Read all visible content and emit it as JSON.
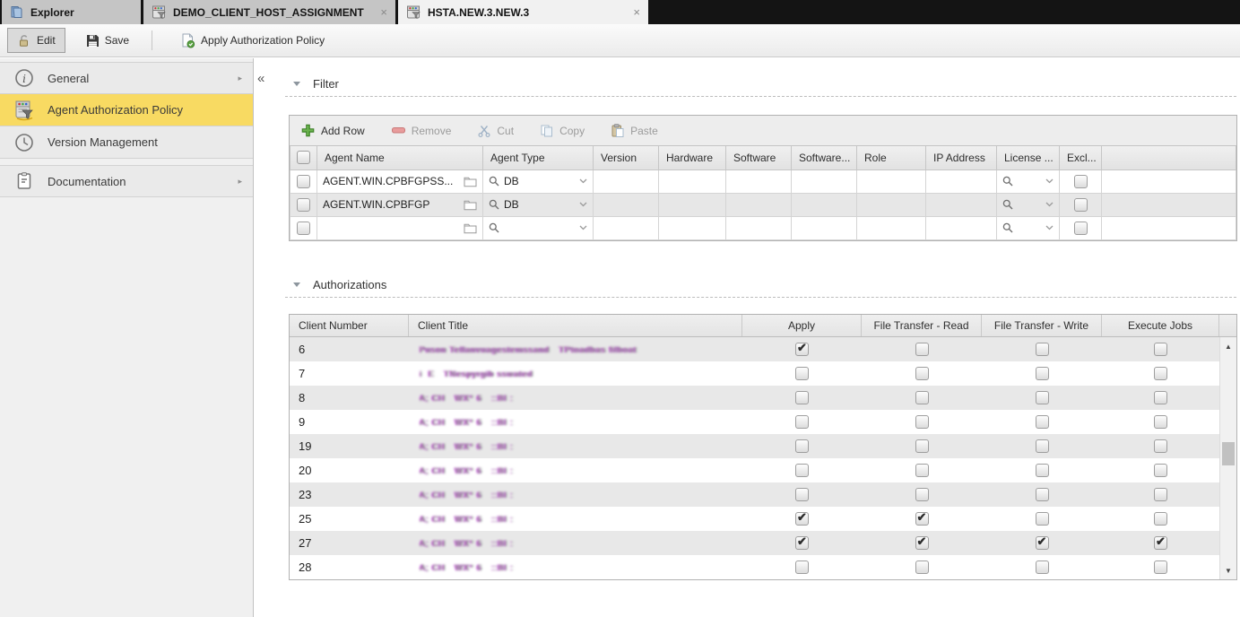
{
  "tabbar": {
    "tabs": [
      {
        "label": "Explorer",
        "icon": "explorer-folder-icon",
        "active": false,
        "closable": false
      },
      {
        "label": "DEMO_CLIENT_HOST_ASSIGNMENT",
        "icon": "host-object-icon",
        "active": false,
        "closable": true
      },
      {
        "label": "HSTA.NEW.3.NEW.3",
        "icon": "host-object-icon",
        "active": true,
        "closable": true
      }
    ],
    "close_glyph": "×"
  },
  "toolbar": {
    "buttons": [
      {
        "label": "Edit",
        "icon": "unlock-icon",
        "pressed": true
      },
      {
        "label": "Save",
        "icon": "save-icon",
        "pressed": false
      },
      {
        "label": "Apply Authorization Policy",
        "icon": "apply-policy-icon",
        "pressed": false
      }
    ]
  },
  "sidebar": {
    "collapse_glyph": "«",
    "items": [
      {
        "label": "General",
        "icon": "info-icon",
        "selected": false,
        "expand_arrow": "▸"
      },
      {
        "label": "Agent Authorization Policy",
        "icon": "agent-policy-icon",
        "selected": true,
        "expand_arrow": ""
      },
      {
        "label": "Version Management",
        "icon": "clock-icon",
        "selected": false,
        "expand_arrow": ""
      },
      {
        "label": "Documentation",
        "icon": "documentation-icon",
        "selected": false,
        "expand_arrow": "▸"
      }
    ]
  },
  "filter_section": {
    "title": "Filter",
    "table": {
      "toolbar": [
        {
          "label": "Add Row",
          "icon": "add-row-icon",
          "enabled": true
        },
        {
          "label": "Remove",
          "icon": "remove-row-icon",
          "enabled": false
        },
        {
          "label": "Cut",
          "icon": "cut-icon",
          "enabled": false
        },
        {
          "label": "Copy",
          "icon": "copy-icon",
          "enabled": false
        },
        {
          "label": "Paste",
          "icon": "paste-icon",
          "enabled": false
        }
      ],
      "columns": [
        "Agent Name",
        "Agent Type",
        "Version",
        "Hardware",
        "Software",
        "Software...",
        "Role",
        "IP Address",
        "License ...",
        "Excl..."
      ],
      "rows": [
        {
          "selected": false,
          "agent_name": "AGENT.WIN.CPBFGPSS...",
          "agent_type": "DB",
          "version": "",
          "hardware": "",
          "software": "",
          "software2": "",
          "role": "",
          "ip_address": "",
          "license": "",
          "excluded": false
        },
        {
          "selected": false,
          "agent_name": "AGENT.WIN.CPBFGP",
          "agent_type": "DB",
          "version": "",
          "hardware": "",
          "software": "",
          "software2": "",
          "role": "",
          "ip_address": "",
          "license": "",
          "excluded": false
        },
        {
          "selected": false,
          "agent_name": "",
          "agent_type": "",
          "version": "",
          "hardware": "",
          "software": "",
          "software2": "",
          "role": "",
          "ip_address": "",
          "license": "",
          "excluded": false
        }
      ]
    }
  },
  "authorizations_section": {
    "title": "Authorizations",
    "table": {
      "columns": [
        "Client Number",
        "Client Title",
        "Apply",
        "File Transfer - Read",
        "File Transfer - Write",
        "Execute Jobs"
      ],
      "rows": [
        {
          "client_number": "6",
          "client_title": "Puson Tellanvuagestemssand   TPtoadbas filboat",
          "title_redacted": true,
          "apply": true,
          "file_transfer_read": false,
          "file_transfer_write": false,
          "execute_jobs": false
        },
        {
          "client_number": "7",
          "client_title": "i  E   TNespyrgib sswated",
          "title_redacted": true,
          "apply": false,
          "file_transfer_read": false,
          "file_transfer_write": false,
          "execute_jobs": false
        },
        {
          "client_number": "8",
          "client_title": "A; CH   WX* 6   ::BI :",
          "title_redacted": true,
          "apply": false,
          "file_transfer_read": false,
          "file_transfer_write": false,
          "execute_jobs": false
        },
        {
          "client_number": "9",
          "client_title": "A; CH   WX* 6   ::BI :",
          "title_redacted": true,
          "apply": false,
          "file_transfer_read": false,
          "file_transfer_write": false,
          "execute_jobs": false
        },
        {
          "client_number": "19",
          "client_title": "A; CH   WX* 6   ::BI :",
          "title_redacted": true,
          "apply": false,
          "file_transfer_read": false,
          "file_transfer_write": false,
          "execute_jobs": false
        },
        {
          "client_number": "20",
          "client_title": "A; CH   WX* 6   ::BI :",
          "title_redacted": true,
          "apply": false,
          "file_transfer_read": false,
          "file_transfer_write": false,
          "execute_jobs": false
        },
        {
          "client_number": "23",
          "client_title": "A; CH   WX* 6   ::BI :",
          "title_redacted": true,
          "apply": false,
          "file_transfer_read": false,
          "file_transfer_write": false,
          "execute_jobs": false
        },
        {
          "client_number": "25",
          "client_title": "A; CH   WX* 6   ::BI :",
          "title_redacted": true,
          "apply": true,
          "file_transfer_read": true,
          "file_transfer_write": false,
          "execute_jobs": false
        },
        {
          "client_number": "27",
          "client_title": "A; CH   WX* 6   ::BI :",
          "title_redacted": true,
          "apply": true,
          "file_transfer_read": true,
          "file_transfer_write": true,
          "execute_jobs": true
        },
        {
          "client_number": "28",
          "client_title": "A; CH   WX* 6   ::BI :",
          "title_redacted": true,
          "apply": false,
          "file_transfer_read": false,
          "file_transfer_write": false,
          "execute_jobs": false
        }
      ]
    }
  },
  "colors": {
    "selection_yellow": "#f8da62",
    "tab_bar_bg": "#141414",
    "add_green": "#4ea33c",
    "remove_red": "#e58c8c",
    "stripe_gray": "#e8e8e8"
  }
}
